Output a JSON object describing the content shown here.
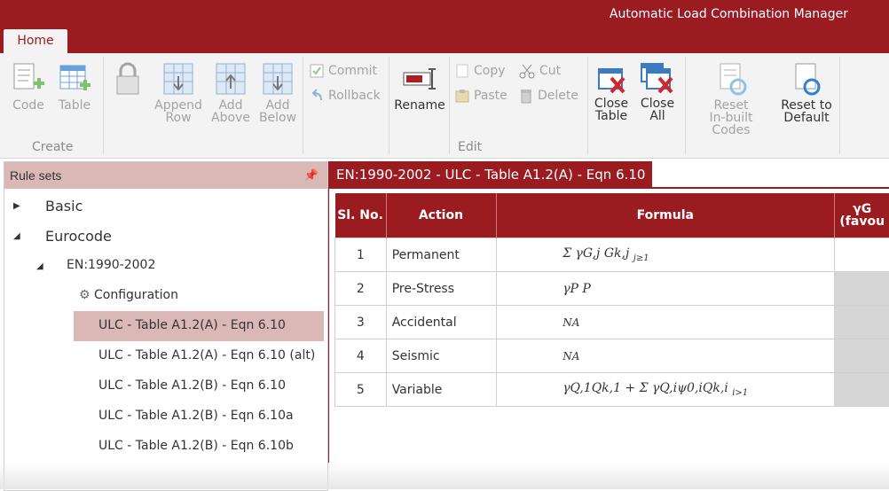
{
  "app_title": "Automatic Load Combination Manager",
  "tab_home": "Home",
  "ribbon": {
    "code": "Code",
    "table": "Table",
    "append1": "Append",
    "append2": "Row",
    "addabove1": "Add",
    "addabove2": "Above",
    "addbelow1": "Add",
    "addbelow2": "Below",
    "commit": "Commit",
    "rollback": "Rollback",
    "rename": "Rename",
    "copy": "Copy",
    "paste": "Paste",
    "cut": "Cut",
    "delete": "Delete",
    "closetable1": "Close",
    "closetable2": "Table",
    "closeall1": "Close",
    "closeall2": "All",
    "reset1": "Reset",
    "reset2": "In-built Codes",
    "resetdef1": "Reset to",
    "resetdef2": "Default",
    "group_create": "Create",
    "group_edit": "Edit"
  },
  "ruleset": {
    "title": "Rule sets",
    "basic": "Basic",
    "eurocode": "Eurocode",
    "en": "EN:1990-2002",
    "config": "Configuration",
    "items": [
      "ULC - Table A1.2(A) - Eqn 6.10",
      "ULC - Table A1.2(A) - Eqn 6.10 (alt)",
      "ULC - Table A1.2(B) - Eqn 6.10",
      "ULC - Table A1.2(B) - Eqn 6.10a",
      "ULC - Table A1.2(B) - Eqn 6.10b"
    ]
  },
  "doc": {
    "tab": "EN:1990-2002 - ULC - Table A1.2(A) - Eqn 6.10",
    "headers": {
      "no": "Sl. No.",
      "action": "Action",
      "formula": "Formula",
      "g1": "γG",
      "g2": "(favou"
    },
    "rows": [
      {
        "no": "1",
        "action": "Permanent",
        "formula": "Σ γG,j Gk,j",
        "sub": "j≥1"
      },
      {
        "no": "2",
        "action": "Pre-Stress",
        "formula": "γP P",
        "sub": ""
      },
      {
        "no": "3",
        "action": "Accidental",
        "formula": "NA",
        "sub": ""
      },
      {
        "no": "4",
        "action": "Seismic",
        "formula": "NA",
        "sub": ""
      },
      {
        "no": "5",
        "action": "Variable",
        "formula": "γQ,1Qk,1 + Σ γQ,iψ0,iQk,i",
        "sub": "i>1"
      }
    ]
  },
  "colors": {
    "accent": "#9b1c20",
    "selection": "#d9b8b6"
  }
}
